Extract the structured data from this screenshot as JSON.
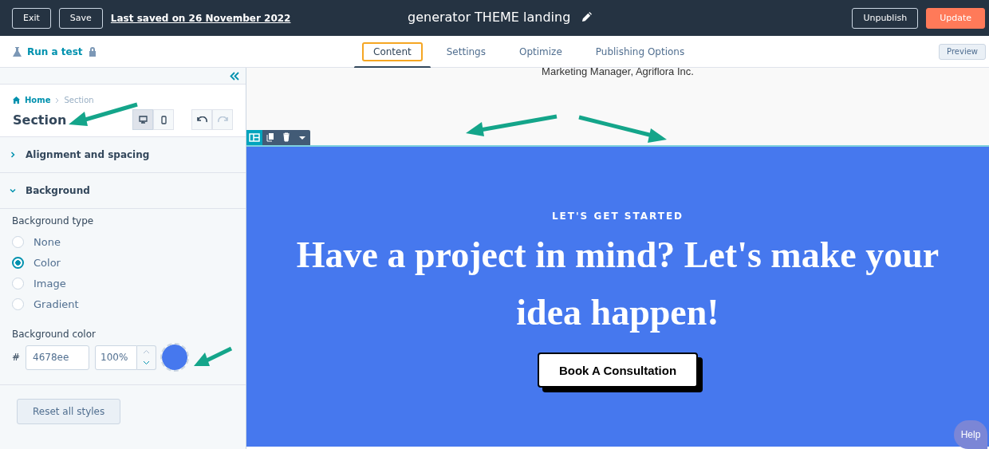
{
  "top_bar": {
    "buttons_left": [
      {
        "label": "Exit"
      },
      {
        "label": "Save"
      }
    ],
    "last_saved": "Last saved on 26 November 2022",
    "title": "generator THEME landing",
    "buttons_right": [
      {
        "label": "Unpublish",
        "kind": "outline"
      },
      {
        "label": "Update",
        "kind": "primary"
      }
    ]
  },
  "sub_bar": {
    "run_test": "Run a test",
    "tabs": [
      {
        "label": "Content",
        "selected": true
      },
      {
        "label": "Settings",
        "selected": false
      },
      {
        "label": "Optimize",
        "selected": false
      },
      {
        "label": "Publishing Options",
        "selected": false
      }
    ],
    "preview": "Preview"
  },
  "panel": {
    "breadcrumb": [
      "Home",
      "Section"
    ],
    "title": "Section",
    "devices": [
      {
        "kind": "desktop",
        "selected": true
      },
      {
        "kind": "mobile",
        "selected": false
      }
    ],
    "history": [
      {
        "kind": "undo",
        "disabled": false
      },
      {
        "kind": "redo",
        "disabled": true
      }
    ],
    "accordions": [
      {
        "label": "Alignment and spacing",
        "expanded": false
      },
      {
        "label": "Background",
        "expanded": true
      }
    ],
    "background_type": {
      "label": "Background type",
      "options": [
        {
          "label": "None",
          "selected": false
        },
        {
          "label": "Color",
          "selected": true
        },
        {
          "label": "Image",
          "selected": false
        },
        {
          "label": "Gradient",
          "selected": false
        }
      ]
    },
    "background_color": {
      "label": "Background color",
      "hash": "#",
      "value": "4678ee",
      "opacity": "100%",
      "color": "#4678ee"
    },
    "reset": "Reset all styles"
  },
  "canvas": {
    "caption": "Marketing Manager, Agriflora Inc.",
    "eyebrow": "LET'S GET STARTED",
    "heading": "Have a project in mind? Let's make your idea happen!",
    "button": "Book A Consultation",
    "help": "Help"
  }
}
